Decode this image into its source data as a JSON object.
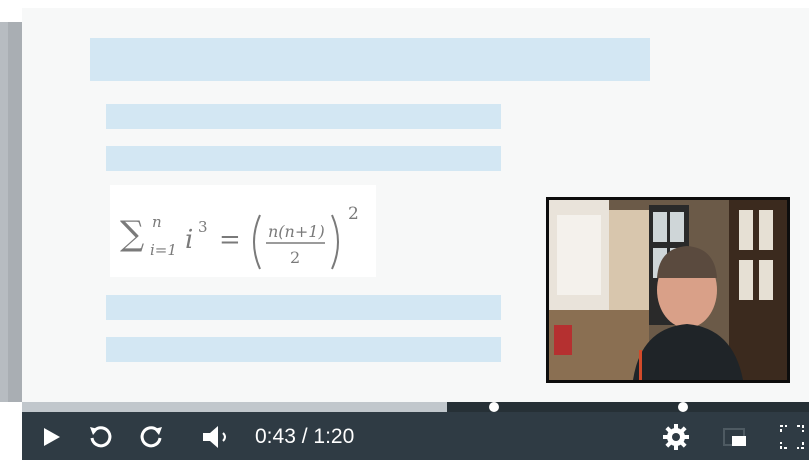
{
  "player": {
    "current_time": "0:43",
    "separator": " / ",
    "duration": "1:20",
    "progress_fraction": 0.54,
    "markers": [
      0.6,
      0.84
    ],
    "icons": {
      "play": "play-icon",
      "rewind": "rewind-icon",
      "forward": "forward-icon",
      "volume": "volume-icon",
      "settings": "gear-icon",
      "pip": "picture-in-picture-icon",
      "fullscreen": "fullscreen-icon"
    }
  },
  "slide": {
    "equation": {
      "lhs_sum": "∑",
      "upper": "n",
      "lower": "i=1",
      "term": "i",
      "term_power": "3",
      "equals": "=",
      "numerator": "n(n+1)",
      "denominator": "2",
      "outer_power": "2"
    }
  },
  "colors": {
    "placeholder_bar": "#d3e7f3",
    "control_bar": "#2f3b44",
    "progress": "#c1c7cc"
  }
}
